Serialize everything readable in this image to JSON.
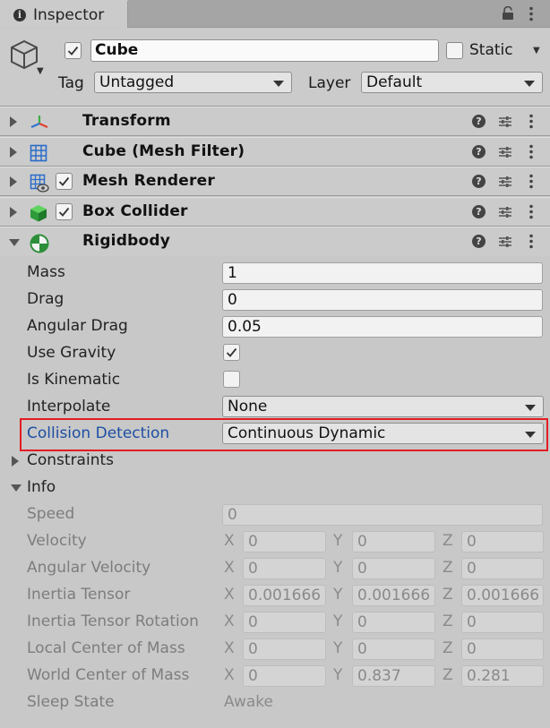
{
  "tab": {
    "icon": "info-icon",
    "label": "Inspector"
  },
  "header": {
    "object_name": "Cube",
    "active": true,
    "static_label": "Static",
    "static_checked": false,
    "tag_label": "Tag",
    "tag_value": "Untagged",
    "layer_label": "Layer",
    "layer_value": "Default"
  },
  "components": [
    {
      "name": "Transform",
      "icon": "transform-icon",
      "has_toggle": false,
      "expanded": false
    },
    {
      "name": "Cube (Mesh Filter)",
      "icon": "mesh-filter-icon",
      "has_toggle": false,
      "expanded": false
    },
    {
      "name": "Mesh Renderer",
      "icon": "mesh-renderer-icon",
      "has_toggle": true,
      "enabled": true,
      "expanded": false
    },
    {
      "name": "Box Collider",
      "icon": "box-collider-icon",
      "has_toggle": true,
      "enabled": true,
      "expanded": false
    },
    {
      "name": "Rigidbody",
      "icon": "rigidbody-icon",
      "has_toggle": false,
      "expanded": true
    }
  ],
  "rigidbody": {
    "mass": {
      "label": "Mass",
      "value": "1"
    },
    "drag": {
      "label": "Drag",
      "value": "0"
    },
    "angular_drag": {
      "label": "Angular Drag",
      "value": "0.05"
    },
    "use_gravity": {
      "label": "Use Gravity",
      "checked": true
    },
    "is_kinematic": {
      "label": "Is Kinematic",
      "checked": false
    },
    "interpolate": {
      "label": "Interpolate",
      "value": "None"
    },
    "collision_detection": {
      "label": "Collision Detection",
      "value": "Continuous Dynamic"
    },
    "constraints": {
      "label": "Constraints"
    },
    "info": {
      "label": "Info"
    }
  },
  "axes": {
    "x": "X",
    "y": "Y",
    "z": "Z"
  },
  "info": {
    "speed": {
      "label": "Speed",
      "value": "0"
    },
    "velocity": {
      "label": "Velocity",
      "x": "0",
      "y": "0",
      "z": "0"
    },
    "angular_velocity": {
      "label": "Angular Velocity",
      "x": "0",
      "y": "0",
      "z": "0"
    },
    "inertia_tensor": {
      "label": "Inertia Tensor",
      "x": "0.001666",
      "y": "0.001666",
      "z": "0.001666"
    },
    "inertia_tensor_rotation": {
      "label": "Inertia Tensor Rotation",
      "x": "0",
      "y": "0",
      "z": "0"
    },
    "local_center_of_mass": {
      "label": "Local Center of Mass",
      "x": "0",
      "y": "0",
      "z": "0"
    },
    "world_center_of_mass": {
      "label": "World Center of Mass",
      "x": "0",
      "y": "0.837",
      "z": "0.281"
    },
    "sleep_state": {
      "label": "Sleep State",
      "value": "Awake"
    }
  },
  "colors": {
    "highlight": "#e21c24",
    "selected_label": "#1d4fa3"
  }
}
